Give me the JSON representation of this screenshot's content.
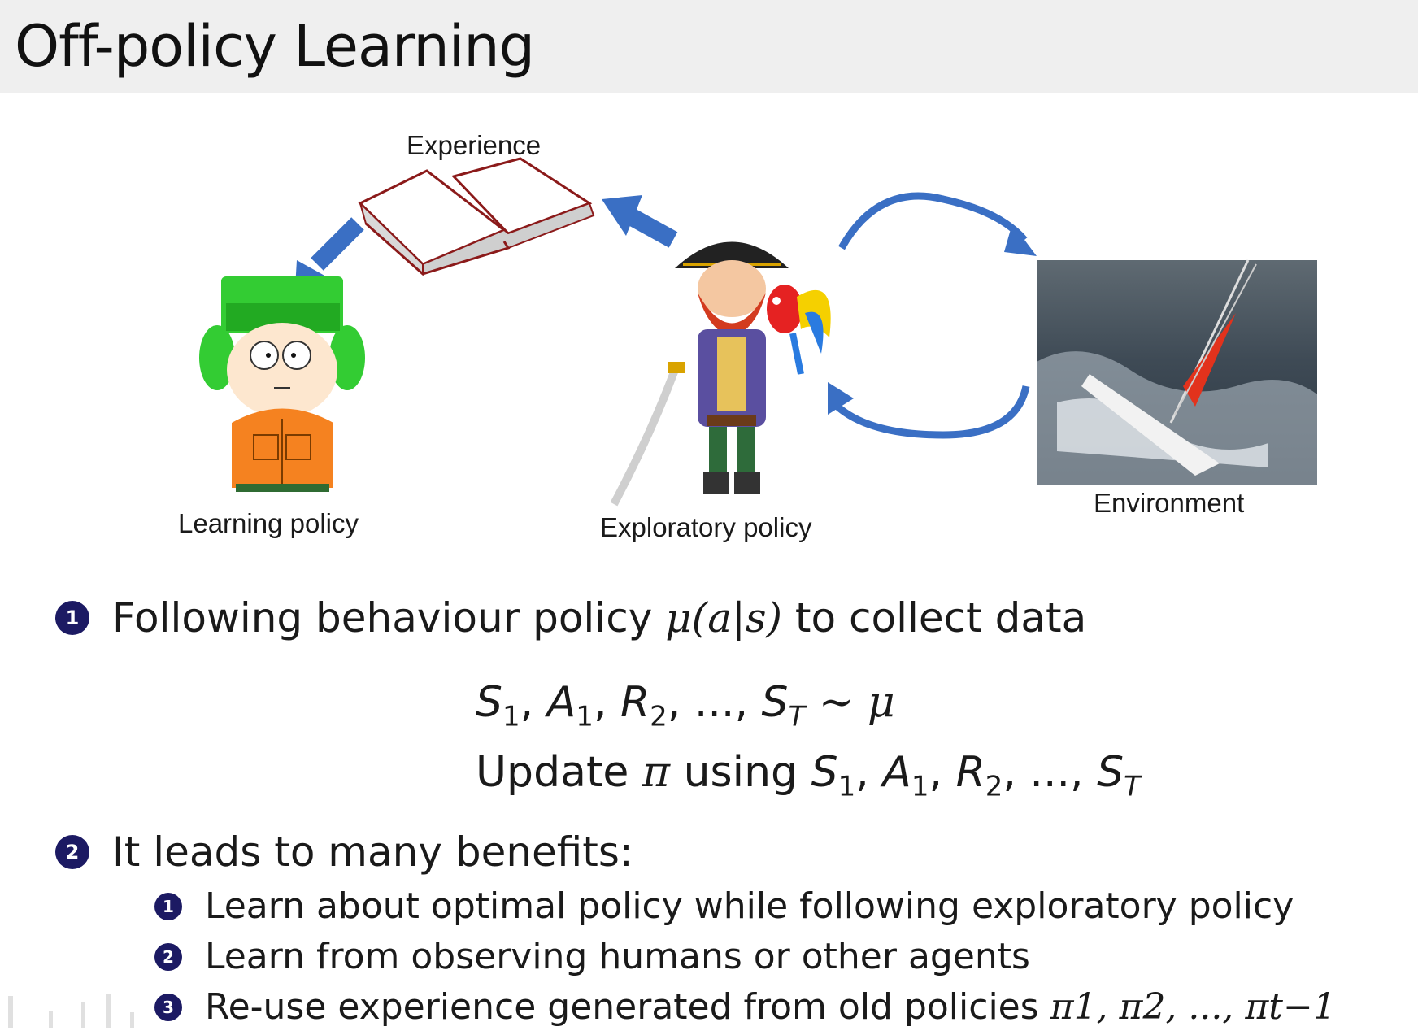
{
  "slide": {
    "title": "Off-policy Learning"
  },
  "diagram": {
    "experience_label": "Experience",
    "learning_policy_label": "Learning policy",
    "exploratory_policy_label": "Exploratory policy",
    "environment_label": "Environment"
  },
  "bullets": {
    "b1": {
      "number": "1",
      "text_before": "Following behaviour policy ",
      "math": "μ(a|s)",
      "text_after": " to collect data"
    },
    "eq1": {
      "s": "S",
      "s_sub": "1",
      "a": "A",
      "a_sub": "1",
      "r": "R",
      "r_sub": "2",
      "dots": "...",
      "st": "S",
      "st_sub": "T",
      "tail": "∼ μ"
    },
    "eq2": {
      "prefix": "Update ",
      "pi": "π",
      "using": " using ",
      "s": "S",
      "s_sub": "1",
      "a": "A",
      "a_sub": "1",
      "r": "R",
      "r_sub": "2",
      "dots": "...",
      "st": "S",
      "st_sub": "T"
    },
    "b2": {
      "number": "2",
      "text": "It leads to many benefits:"
    },
    "sub": [
      {
        "number": "1",
        "text": "Learn about optimal policy while following exploratory policy"
      },
      {
        "number": "2",
        "text": "Learn from observing humans or other agents"
      },
      {
        "number": "3",
        "text": "Re-use experience generated from old policies ",
        "math": "π1, π2, ..., πt−1"
      }
    ]
  },
  "colors": {
    "arrow_blue": "#3a6fc4",
    "bullet_navy": "#1c1a63",
    "title_bar": "#efefef"
  }
}
